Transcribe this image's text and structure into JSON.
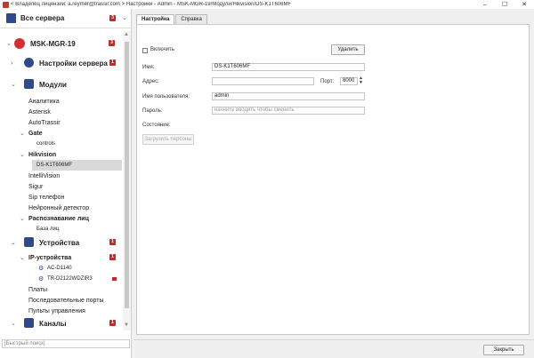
{
  "window": {
    "title": "< Владелец лицензии: a.reymer@trassir.com > Настройки - Admin - MSK-MGR-19/Модули/Hikvision/DS-K1T606MF",
    "minimize": "–",
    "maximize": "☐",
    "close": "✕"
  },
  "sidebar": {
    "all_servers": {
      "label": "Все сервера",
      "badge": "3"
    },
    "server": {
      "label": "MSK-MGR-19",
      "badge": "3"
    },
    "server_settings": {
      "label": "Настройки сервера",
      "badge": "1"
    },
    "modules": {
      "label": "Модули"
    },
    "items": {
      "analytics": "Аналитика",
      "asterisk": "Asterisk",
      "autotrassir": "AutoTrassir",
      "gate": "Gate",
      "controls": "controls",
      "hikvision": "Hikvision",
      "ds_k1t606mf": "DS-K1T606MF",
      "intellivision": "IntelliVision",
      "sigur": "Sigur",
      "sip_phone": "Sip телефон",
      "neuro_detector": "Нейронный детектор",
      "face_recognition": "Распознавание лиц",
      "face_base": "База лиц"
    },
    "devices": {
      "label": "Устройства",
      "badge": "1"
    },
    "ip_devices": {
      "label": "IP-устройства",
      "badge": "1"
    },
    "ac_d1140": "AC-D1140",
    "tr_d2122": "TR-D2122WDZIR3",
    "boards": "Платы",
    "serial_ports": "Последовательные порты",
    "control_panels": "Пульты управления",
    "channels": {
      "label": "Каналы",
      "badge": "1"
    },
    "search_placeholder": "[Быстрый поиск]"
  },
  "tabs": [
    "Настройка",
    "Справка"
  ],
  "form": {
    "enable_label": "Включить",
    "delete_button": "Удалить",
    "name_label": "Имя:",
    "name_value": "DS-K1T606MF",
    "address_label": "Адрес:",
    "address_value": "",
    "port_label": "Порт:",
    "port_value": "8000",
    "username_label": "Имя пользователя:",
    "username_value": "admin",
    "password_label": "Пароль:",
    "password_placeholder": "начните вводить чтобы сменить",
    "state_label": "Состояние:",
    "load_persons_button": "Загрузить персоны"
  },
  "footer": {
    "close_button": "Закрыть"
  },
  "colors": {
    "accent_red": "#c62828",
    "server_red": "#d32f2f",
    "navy": "#2e4a8a"
  }
}
